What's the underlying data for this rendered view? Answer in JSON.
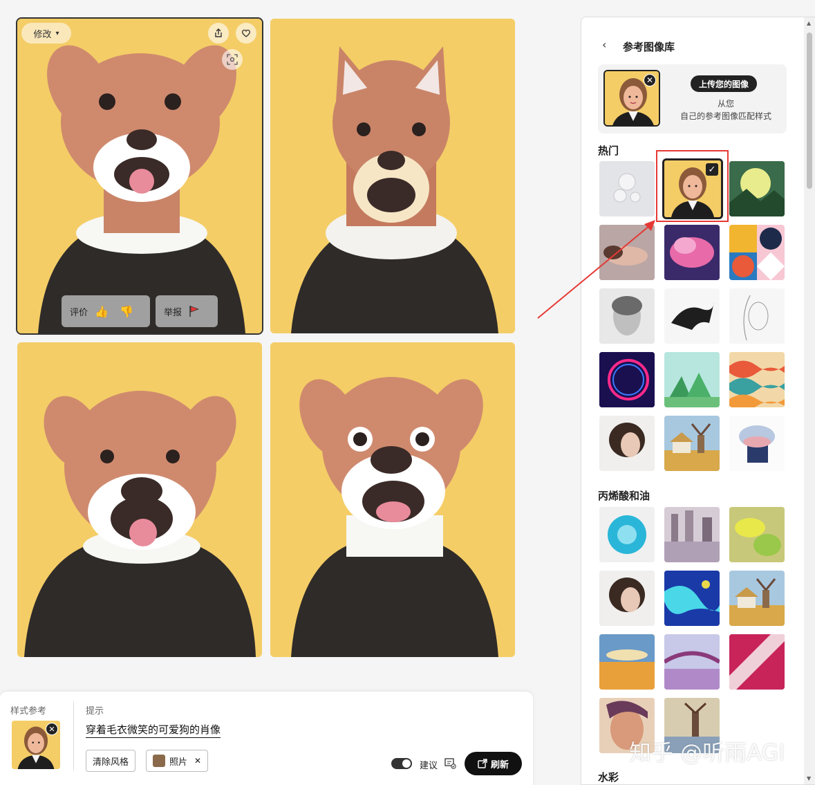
{
  "results": {
    "modify_label": "修改",
    "rate_label": "评价",
    "report_label": "举报"
  },
  "panel": {
    "title": "参考图像库",
    "upload_button": "上传您的图像",
    "upload_desc_line1": "从您",
    "upload_desc_line2": "自己的参考图像匹配样式",
    "sections": [
      {
        "title": "热门"
      },
      {
        "title": "丙烯酸和油"
      },
      {
        "title": "水彩"
      }
    ]
  },
  "prompt_bar": {
    "style_ref_label": "样式参考",
    "prompt_label": "提示",
    "prompt_text": "穿着毛衣微笑的可爱狗的肖像",
    "clear_style": "清除风格",
    "photo_chip": "照片",
    "suggest_label": "建议",
    "refresh_label": "刷新"
  },
  "watermark": "知乎 @听雨AGI",
  "colors": {
    "accent": "#e53935",
    "card_bg": "#f4cd66",
    "dark": "#222222"
  }
}
